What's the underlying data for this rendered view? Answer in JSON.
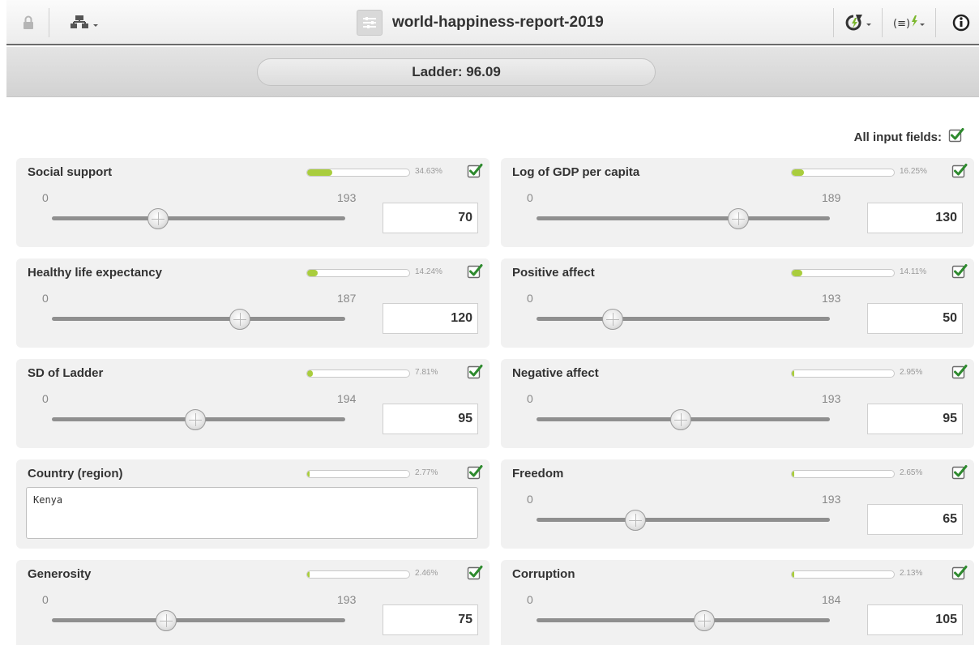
{
  "toolbar": {
    "title": "world-happiness-report-2019",
    "icons": [
      "lock-icon",
      "model-tree-icon",
      "title-model-icon",
      "refresh-lightning-icon",
      "formula-lightning-icon",
      "info-icon"
    ],
    "accent_green": "#a9cd3d",
    "check_green": "#2e8a2e"
  },
  "prediction": {
    "text": "Ladder: 96.09"
  },
  "all_fields": {
    "label": "All input fields:",
    "checked": true
  },
  "fields": [
    {
      "name": "Social support",
      "importance": "34.63%",
      "importance_value": 34.63,
      "type": "numeric",
      "min": "0",
      "max": "193",
      "value": "70",
      "checked": true
    },
    {
      "name": "Log of GDP per capita",
      "importance": "16.25%",
      "importance_value": 16.25,
      "type": "numeric",
      "min": "0",
      "max": "189",
      "value": "130",
      "checked": true
    },
    {
      "name": "Healthy life expectancy",
      "importance": "14.24%",
      "importance_value": 14.24,
      "type": "numeric",
      "min": "0",
      "max": "187",
      "value": "120",
      "checked": true
    },
    {
      "name": "Positive affect",
      "importance": "14.11%",
      "importance_value": 14.11,
      "type": "numeric",
      "min": "0",
      "max": "193",
      "value": "50",
      "checked": true
    },
    {
      "name": "SD of Ladder",
      "importance": "7.81%",
      "importance_value": 7.81,
      "type": "numeric",
      "min": "0",
      "max": "194",
      "value": "95",
      "checked": true
    },
    {
      "name": "Negative affect",
      "importance": "2.95%",
      "importance_value": 2.95,
      "type": "numeric",
      "min": "0",
      "max": "193",
      "value": "95",
      "checked": true
    },
    {
      "name": "Country (region)",
      "importance": "2.77%",
      "importance_value": 2.77,
      "type": "text",
      "value": "Kenya",
      "checked": true
    },
    {
      "name": "Freedom",
      "importance": "2.65%",
      "importance_value": 2.65,
      "type": "numeric",
      "min": "0",
      "max": "193",
      "value": "65",
      "checked": true
    },
    {
      "name": "Generosity",
      "importance": "2.46%",
      "importance_value": 2.46,
      "type": "numeric",
      "min": "0",
      "max": "193",
      "value": "75",
      "checked": true
    },
    {
      "name": "Corruption",
      "importance": "2.13%",
      "importance_value": 2.13,
      "type": "numeric",
      "min": "0",
      "max": "184",
      "value": "105",
      "checked": true
    }
  ]
}
